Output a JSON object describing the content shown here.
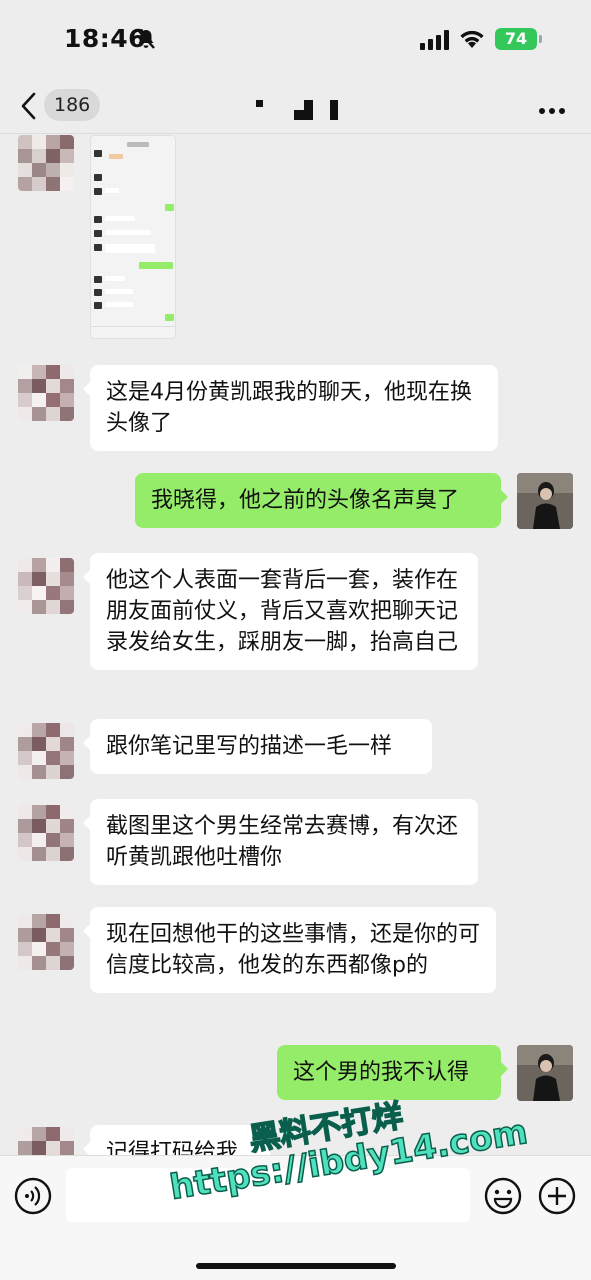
{
  "status_bar": {
    "time": "18:46",
    "battery": "74"
  },
  "nav": {
    "unread_count": "186"
  },
  "messages": [
    {
      "side": "in",
      "type": "image"
    },
    {
      "side": "in",
      "text": "这是4月份黄凯跟我的聊天，他现在换头像了"
    },
    {
      "side": "out",
      "text": "我晓得，他之前的头像名声臭了"
    },
    {
      "side": "in",
      "text": "他这个人表面一套背后一套，装作在朋友面前仗义，背后又喜欢把聊天记录发给女生，踩朋友一脚，抬高自己"
    },
    {
      "side": "in",
      "text": "跟你笔记里写的描述一毛一样"
    },
    {
      "side": "in",
      "text": "截图里这个男生经常去赛博，有次还听黄凯跟他吐槽你"
    },
    {
      "side": "in",
      "text": "现在回想他干的这些事情，还是你的可信度比较高，他发的东西都像p的"
    },
    {
      "side": "out",
      "text": "这个男的我不认得"
    },
    {
      "side": "in",
      "text": "记得打码给我"
    }
  ],
  "input_bar": {
    "placeholder": ""
  },
  "watermark": {
    "line1": "黑料不打烊",
    "line2": "https://ibdy14.com"
  },
  "colors": {
    "background": "#ededed",
    "bubble_out": "#95ec69",
    "bubble_in": "#ffffff",
    "battery": "#34c759"
  },
  "icons": [
    "back-icon",
    "more-icon",
    "bell-slash-icon",
    "signal-icon",
    "wifi-icon",
    "voice-icon",
    "emoji-icon",
    "plus-icon"
  ]
}
